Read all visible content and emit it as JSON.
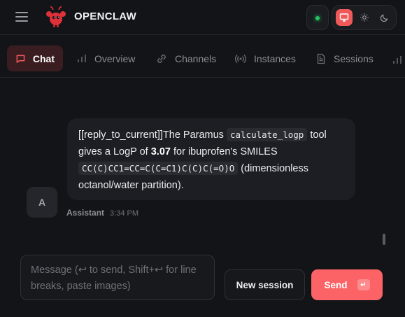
{
  "header": {
    "brand": "OPENCLAW",
    "status_color": "#22c55e",
    "theme_modes": [
      "system-monitor-icon",
      "sun-icon",
      "moon-icon"
    ],
    "active_theme": "system"
  },
  "tabs": [
    {
      "label": "Chat",
      "icon": "chat-bubble-icon",
      "active": true
    },
    {
      "label": "Overview",
      "icon": "bar-chart-icon",
      "active": false
    },
    {
      "label": "Channels",
      "icon": "link-icon",
      "active": false
    },
    {
      "label": "Instances",
      "icon": "broadcast-icon",
      "active": false
    },
    {
      "label": "Sessions",
      "icon": "document-icon",
      "active": false
    }
  ],
  "message": {
    "avatar_initial": "A",
    "sender": "Assistant",
    "time": "3:34 PM",
    "text_1": "[[reply_to_current]]The Paramus ",
    "code_tool": "calculate_logp",
    "text_2": " tool gives a LogP of ",
    "logp_value": "3.07",
    "text_3": " for ibuprofen's SMILES ",
    "code_smiles": "CC(C)CC1=CC=C(C=C1)C(C)C(=O)O",
    "text_4": " (dimensionless octanol/water partition)."
  },
  "composer": {
    "placeholder": "Message (↩ to send, Shift+↩ for line breaks, paste images)",
    "new_session_label": "New session",
    "send_label": "Send",
    "send_hint": "↵"
  },
  "colors": {
    "accent": "#fb6366",
    "background": "#131417",
    "active_tab_bg": "#3a1d21"
  }
}
